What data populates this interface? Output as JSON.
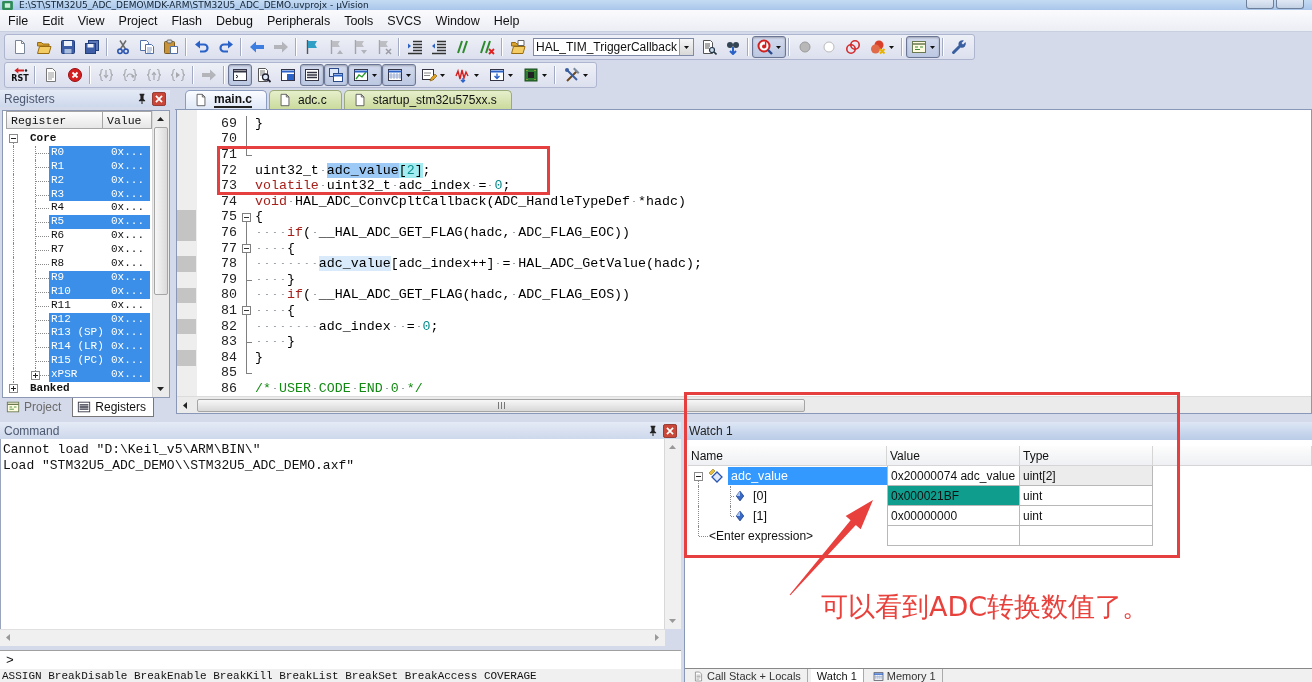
{
  "window": {
    "title": "E:\\ST\\STM32U5_ADC_DEMO\\MDK-ARM\\STM32U5_ADC_DEMO.uvprojx - µVision"
  },
  "menu": [
    "File",
    "Edit",
    "View",
    "Project",
    "Flash",
    "Debug",
    "Peripherals",
    "Tools",
    "SVCS",
    "Window",
    "Help"
  ],
  "toolbars": [
    [
      [
        {
          "kind": "button",
          "on": false,
          "disabled": false
        },
        {
          "kind": "button",
          "on": false,
          "disabled": false
        },
        {
          "kind": "button",
          "on": false,
          "disabled": false
        },
        {
          "kind": "button",
          "on": false,
          "disabled": false
        }
      ],
      [
        {
          "kind": "button",
          "on": false,
          "disabled": false
        },
        {
          "kind": "button",
          "on": false,
          "disabled": false
        },
        {
          "kind": "button",
          "on": false,
          "disabled": false
        }
      ],
      [
        {
          "kind": "button",
          "on": false,
          "disabled": false
        },
        {
          "kind": "button",
          "on": false,
          "disabled": false
        }
      ],
      [
        {
          "kind": "button",
          "on": false,
          "disabled": false
        },
        {
          "kind": "button",
          "on": false,
          "disabled": true
        }
      ],
      [
        {
          "kind": "button",
          "on": false,
          "disabled": false
        },
        {
          "kind": "button",
          "on": false,
          "disabled": true
        },
        {
          "kind": "button",
          "on": false,
          "disabled": true
        },
        {
          "kind": "button",
          "on": false,
          "disabled": true
        }
      ],
      [
        {
          "kind": "button",
          "on": false,
          "disabled": false
        },
        {
          "kind": "button",
          "on": false,
          "disabled": false
        },
        {
          "kind": "button",
          "on": false,
          "disabled": false
        },
        {
          "kind": "button",
          "on": false,
          "disabled": false
        }
      ],
      [
        {
          "kind": "button",
          "on": false,
          "disabled": false
        },
        {
          "kind": "combo",
          "value": "HAL_TIM_TriggerCallback"
        },
        {
          "kind": "button",
          "on": false,
          "disabled": false
        },
        {
          "kind": "button",
          "on": false,
          "disabled": false
        }
      ],
      [
        {
          "kind": "split",
          "on": true,
          "disabled": false
        }
      ],
      [
        {
          "kind": "button",
          "on": false,
          "disabled": false
        },
        {
          "kind": "button",
          "on": false,
          "disabled": false
        },
        {
          "kind": "button",
          "on": false,
          "disabled": false
        },
        {
          "kind": "split",
          "on": false,
          "disabled": false
        }
      ],
      [
        {
          "kind": "split",
          "on": true,
          "disabled": false
        }
      ],
      [
        {
          "kind": "button",
          "on": false,
          "disabled": false
        }
      ]
    ],
    [
      [
        {
          "kind": "button",
          "label": "RST",
          "on": false,
          "disabled": false
        }
      ],
      [
        {
          "kind": "button",
          "on": false,
          "disabled": false
        },
        {
          "kind": "button",
          "on": false,
          "disabled": false
        }
      ],
      [
        {
          "kind": "button",
          "on": false,
          "disabled": true
        },
        {
          "kind": "button",
          "on": false,
          "disabled": true
        },
        {
          "kind": "button",
          "on": false,
          "disabled": true
        },
        {
          "kind": "button",
          "on": false,
          "disabled": true
        }
      ],
      [
        {
          "kind": "button",
          "on": false,
          "disabled": true
        }
      ],
      [
        {
          "kind": "button",
          "on": true,
          "disabled": false
        },
        {
          "kind": "button",
          "on": false,
          "disabled": false
        },
        {
          "kind": "button",
          "on": false,
          "disabled": false
        },
        {
          "kind": "button",
          "on": true,
          "disabled": false
        },
        {
          "kind": "button",
          "on": true,
          "disabled": false
        },
        {
          "kind": "split",
          "on": true,
          "disabled": false
        },
        {
          "kind": "split",
          "on": true,
          "disabled": false
        },
        {
          "kind": "split",
          "on": false,
          "disabled": false
        },
        {
          "kind": "split",
          "on": false,
          "disabled": false
        },
        {
          "kind": "split",
          "on": false,
          "disabled": false
        },
        {
          "kind": "split",
          "on": false,
          "disabled": false
        }
      ],
      [
        {
          "kind": "split",
          "on": false,
          "disabled": false
        }
      ]
    ]
  ],
  "registers_panel": {
    "title": "Registers",
    "columns": [
      "Register",
      "Value"
    ],
    "tree": [
      {
        "name": "Core",
        "expanded": true,
        "children": [
          {
            "name": "R0",
            "value": "0x...",
            "selected": true
          },
          {
            "name": "R1",
            "value": "0x...",
            "selected": true
          },
          {
            "name": "R2",
            "value": "0x...",
            "selected": true
          },
          {
            "name": "R3",
            "value": "0x...",
            "selected": true
          },
          {
            "name": "R4",
            "value": "0x...",
            "selected": false
          },
          {
            "name": "R5",
            "value": "0x...",
            "selected": true
          },
          {
            "name": "R6",
            "value": "0x...",
            "selected": false
          },
          {
            "name": "R7",
            "value": "0x...",
            "selected": false
          },
          {
            "name": "R8",
            "value": "0x...",
            "selected": false
          },
          {
            "name": "R9",
            "value": "0x...",
            "selected": true
          },
          {
            "name": "R10",
            "value": "0x...",
            "selected": true
          },
          {
            "name": "R11",
            "value": "0x...",
            "selected": false
          },
          {
            "name": "R12",
            "value": "0x...",
            "selected": true
          },
          {
            "name": "R13 (SP)",
            "value": "0x...",
            "selected": true
          },
          {
            "name": "R14 (LR)",
            "value": "0x...",
            "selected": true
          },
          {
            "name": "R15 (PC)",
            "value": "0x...",
            "selected": true
          },
          {
            "name": "xPSR",
            "value": "0x...",
            "selected": true,
            "expanded": false
          }
        ]
      },
      {
        "name": "Banked",
        "expanded": false
      }
    ],
    "tabs": [
      {
        "label": "Project",
        "selected": false
      },
      {
        "label": "Registers",
        "selected": true
      }
    ]
  },
  "editor": {
    "tabs": [
      {
        "label": "main.c",
        "selected": true
      },
      {
        "label": "adc.c",
        "selected": false
      },
      {
        "label": "startup_stm32u575xx.s",
        "selected": false
      }
    ],
    "lines": [
      {
        "number": "69",
        "executable": false,
        "fold": {
          "kind": "line"
        },
        "tokens": [
          {
            "text": "}",
            "kind": "plain"
          }
        ]
      },
      {
        "number": "70",
        "executable": false,
        "fold": {
          "kind": "line"
        }
      },
      {
        "number": "71",
        "executable": false,
        "fold": {
          "kind": "end"
        }
      },
      {
        "number": "72",
        "executable": false,
        "tokens": [
          {
            "text": "uint32_t ",
            "kind": "plain"
          },
          {
            "text": "adc_value",
            "kind": "plain",
            "highlight": {
              "kind": "selection"
            }
          },
          {
            "text": "[",
            "kind": "plain",
            "highlight": {
              "kind": "brace"
            }
          },
          {
            "text": "2",
            "kind": "number",
            "highlight": {
              "kind": "brace"
            }
          },
          {
            "text": "]",
            "kind": "plain",
            "highlight": {
              "kind": "brace"
            }
          },
          {
            "text": ";",
            "kind": "plain"
          }
        ]
      },
      {
        "number": "73",
        "executable": false,
        "tokens": [
          {
            "text": "volatile",
            "kind": "keyword"
          },
          {
            "text": " uint32_t adc_index = ",
            "kind": "plain"
          },
          {
            "text": "0",
            "kind": "number"
          },
          {
            "text": ";",
            "kind": "plain"
          }
        ]
      },
      {
        "number": "74",
        "executable": false,
        "tokens": [
          {
            "text": "void",
            "kind": "keyword"
          },
          {
            "text": " HAL_ADC_ConvCpltCallback(ADC_HandleTypeDef *hadc)",
            "kind": "plain"
          }
        ]
      },
      {
        "number": "75",
        "executable": true,
        "fold": {
          "kind": "open"
        },
        "tokens": [
          {
            "text": "{",
            "kind": "plain"
          }
        ]
      },
      {
        "number": "76",
        "executable": true,
        "fold": {
          "kind": "line"
        },
        "tokens": [
          {
            "text": "    if",
            "kind": "keyword"
          },
          {
            "text": "( __HAL_ADC_GET_FLAG(hadc, ADC_FLAG_EOC))",
            "kind": "plain"
          }
        ]
      },
      {
        "number": "77",
        "executable": false,
        "fold": {
          "kind": "open"
        },
        "tokens": [
          {
            "text": "    {",
            "kind": "plain"
          }
        ]
      },
      {
        "number": "78",
        "executable": true,
        "fold": {
          "kind": "line"
        },
        "tokens": [
          {
            "text": "        adc_value",
            "kind": "plain",
            "highlight": {
              "kind": "occurrence"
            }
          },
          {
            "text": "[adc_index++] = HAL_ADC_GetValue(hadc);",
            "kind": "plain"
          }
        ]
      },
      {
        "number": "79",
        "executable": false,
        "fold": {
          "kind": "branch"
        },
        "tokens": [
          {
            "text": "    }",
            "kind": "plain"
          }
        ]
      },
      {
        "number": "80",
        "executable": true,
        "fold": {
          "kind": "line"
        },
        "tokens": [
          {
            "text": "    if",
            "kind": "keyword"
          },
          {
            "text": "( __HAL_ADC_GET_FLAG(hadc, ADC_FLAG_EOS))",
            "kind": "plain"
          }
        ]
      },
      {
        "number": "81",
        "executable": false,
        "fold": {
          "kind": "open"
        },
        "tokens": [
          {
            "text": "    {",
            "kind": "plain"
          }
        ]
      },
      {
        "number": "82",
        "executable": true,
        "fold": {
          "kind": "line"
        },
        "tokens": [
          {
            "text": "        adc_index  = ",
            "kind": "plain"
          },
          {
            "text": "0",
            "kind": "number"
          },
          {
            "text": ";",
            "kind": "plain"
          }
        ]
      },
      {
        "number": "83",
        "executable": false,
        "fold": {
          "kind": "branch"
        },
        "tokens": [
          {
            "text": "    }",
            "kind": "plain"
          }
        ]
      },
      {
        "number": "84",
        "executable": true,
        "fold": {
          "kind": "line"
        },
        "tokens": [
          {
            "text": "}",
            "kind": "plain"
          }
        ]
      },
      {
        "number": "85",
        "executable": false,
        "fold": {
          "kind": "end"
        }
      },
      {
        "number": "86",
        "executable": false,
        "tokens": [
          {
            "text": "/* USER CODE END 0 */",
            "kind": "comment"
          }
        ]
      }
    ]
  },
  "command": {
    "title": "Command",
    "lines": [
      "Cannot load \"D:\\Keil_v5\\ARM\\BIN\\\"",
      "Load \"STM32U5_ADC_DEMO\\\\STM32U5_ADC_DEMO.axf\""
    ],
    "prompt": ">",
    "hint": "ASSIGN BreakDisable BreakEnable BreakKill BreakList BreakSet BreakAccess COVERAGE"
  },
  "watch": {
    "title": "Watch 1",
    "columns": [
      "Name",
      "Value",
      "Type"
    ],
    "rows": [
      {
        "name": "adc_value",
        "value": "0x20000074 adc_value",
        "type": "uint[2]",
        "selected": true,
        "changed": false,
        "expanded": true,
        "children": [
          {
            "name": "[0]",
            "value": "0x000021BF",
            "type": "uint",
            "selected": false,
            "changed": true
          },
          {
            "name": "[1]",
            "value": "0x00000000",
            "type": "uint",
            "selected": false,
            "changed": false
          }
        ]
      }
    ],
    "placeholder": "<Enter expression>",
    "tabs": [
      {
        "label": "Call Stack + Locals",
        "selected": false
      },
      {
        "label": "Watch 1",
        "selected": true
      },
      {
        "label": "Memory 1",
        "selected": false
      }
    ]
  },
  "annotations": [
    {
      "kind": "box"
    },
    {
      "kind": "box"
    },
    {
      "kind": "arrow"
    },
    {
      "kind": "note",
      "text": "可以看到ADC转换数值了。"
    }
  ]
}
